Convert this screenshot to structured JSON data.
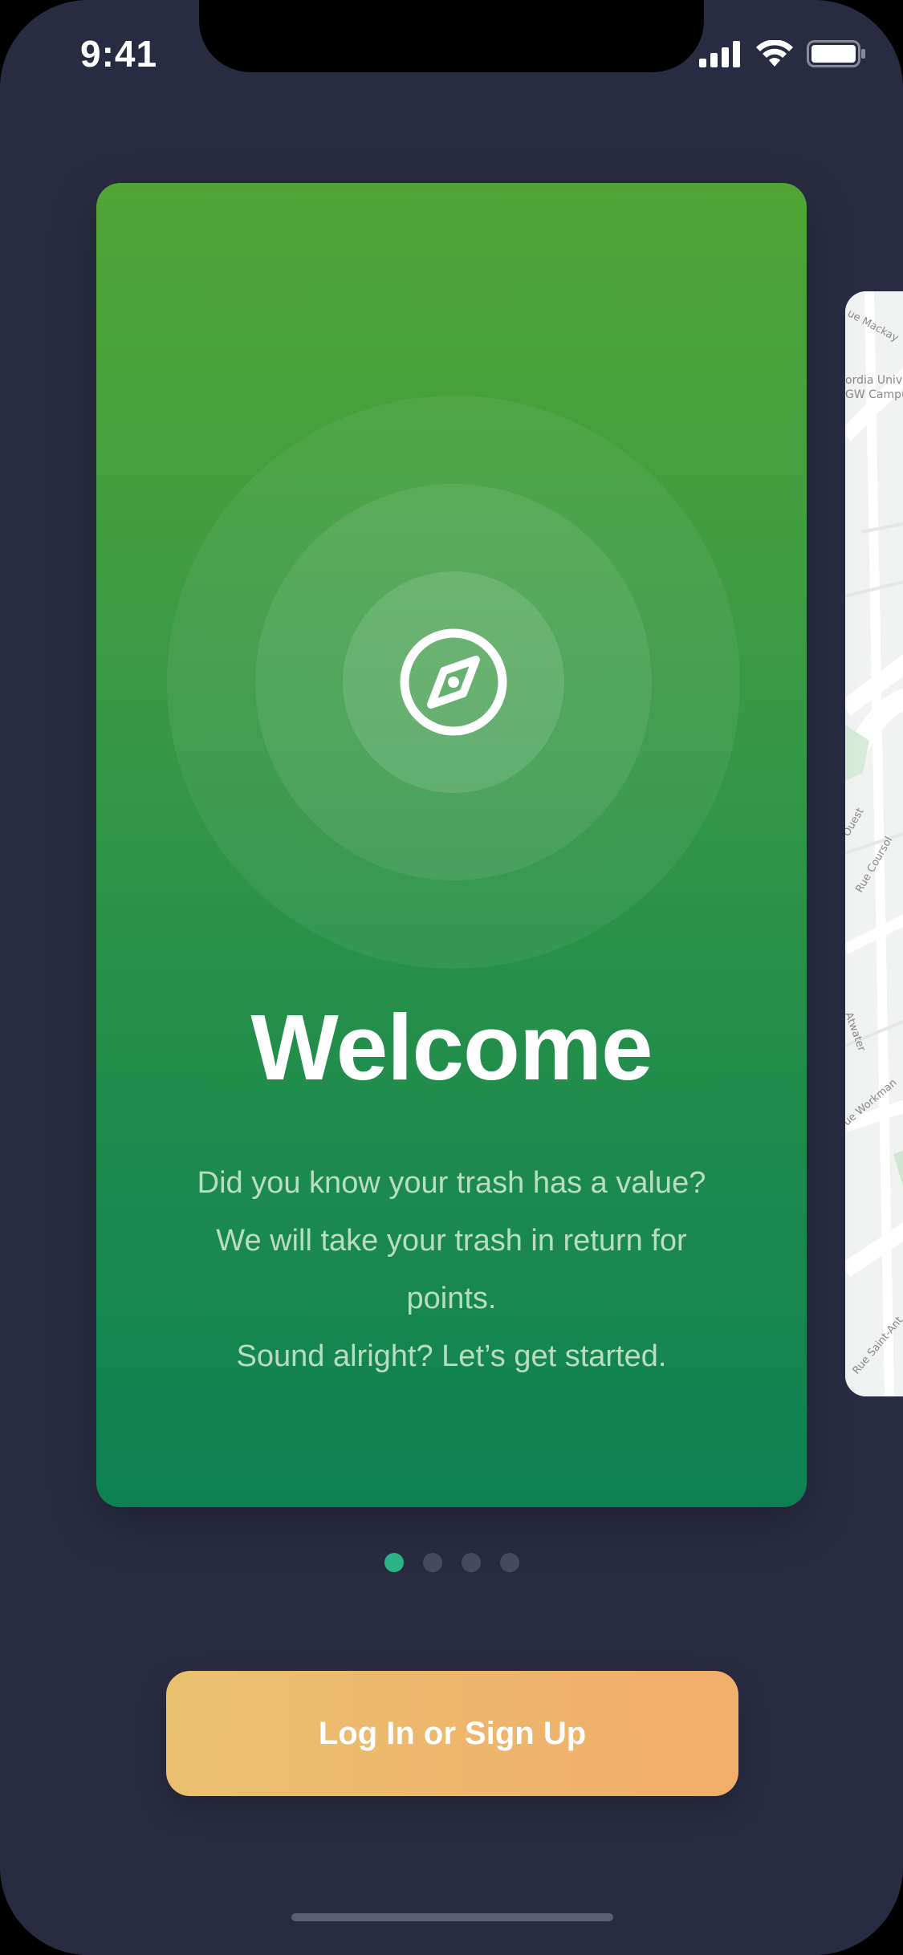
{
  "status_bar": {
    "time": "9:41",
    "icons": [
      "cellular-signal-icon",
      "wifi-icon",
      "battery-icon"
    ]
  },
  "onboarding": {
    "active_slide": 1,
    "slide_count": 4,
    "welcome_card": {
      "icon": "compass-icon",
      "title": "Welcome",
      "body_lines": [
        "Did you know your trash has a value?",
        "We will take your trash in return for",
        "points.",
        "Sound alright? Let’s get started."
      ]
    },
    "next_card_map_labels": [
      "ue Mackay",
      "ordia Univer",
      "GW Campus",
      "Ouest",
      "Rue Coursol",
      "Atwater",
      "ue Workman",
      "Rue Saint-Ant"
    ]
  },
  "actions": {
    "login_label": "Log In or Sign Up"
  },
  "colors": {
    "background": "#292c41",
    "card_gradient_top": "#52a535",
    "card_gradient_bottom": "#0e8154",
    "dot_active": "#2bb387",
    "dot_inactive": "#474a5e",
    "button_gradient_left": "#eac16f",
    "button_gradient_right": "#f1ad6a"
  }
}
